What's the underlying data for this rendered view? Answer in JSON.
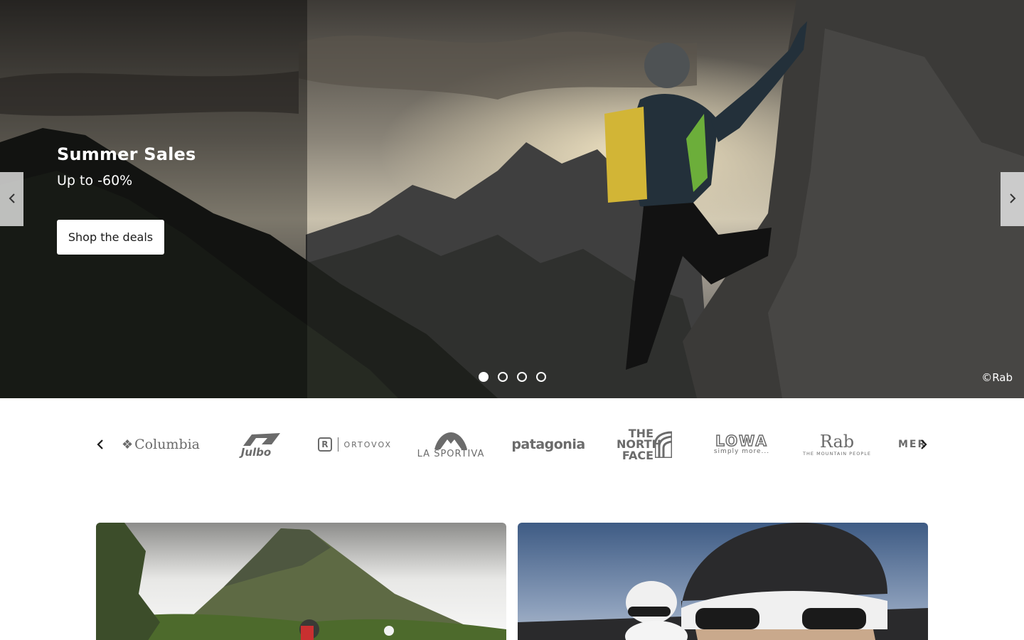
{
  "hero": {
    "title": "Summer Sales",
    "subtitle": "Up to -60%",
    "cta_label": "Shop the deals",
    "credit": "©Rab",
    "slide_count": 4,
    "active_slide": 1
  },
  "brands": {
    "items": [
      {
        "name": "Columbia"
      },
      {
        "name": "Julbo"
      },
      {
        "name": "ORTOVOX"
      },
      {
        "name": "LA SPORTIVA"
      },
      {
        "name": "patagonia"
      },
      {
        "name": "THE NORTH FACE"
      },
      {
        "name": "LOWA",
        "tagline": "simply more..."
      },
      {
        "name": "Rab",
        "tagline": "THE MOUNTAIN PEOPLE"
      },
      {
        "name": "MER"
      }
    ]
  },
  "colors": {
    "cta_bg": "#ffffff",
    "logo_gray": "#6b6b6b",
    "page_bg": "#ffffff"
  },
  "icons": {
    "hero_prev": "chevron-left-icon",
    "hero_next": "chevron-right-icon",
    "brands_prev": "chevron-left-icon",
    "brands_next": "chevron-right-icon"
  }
}
